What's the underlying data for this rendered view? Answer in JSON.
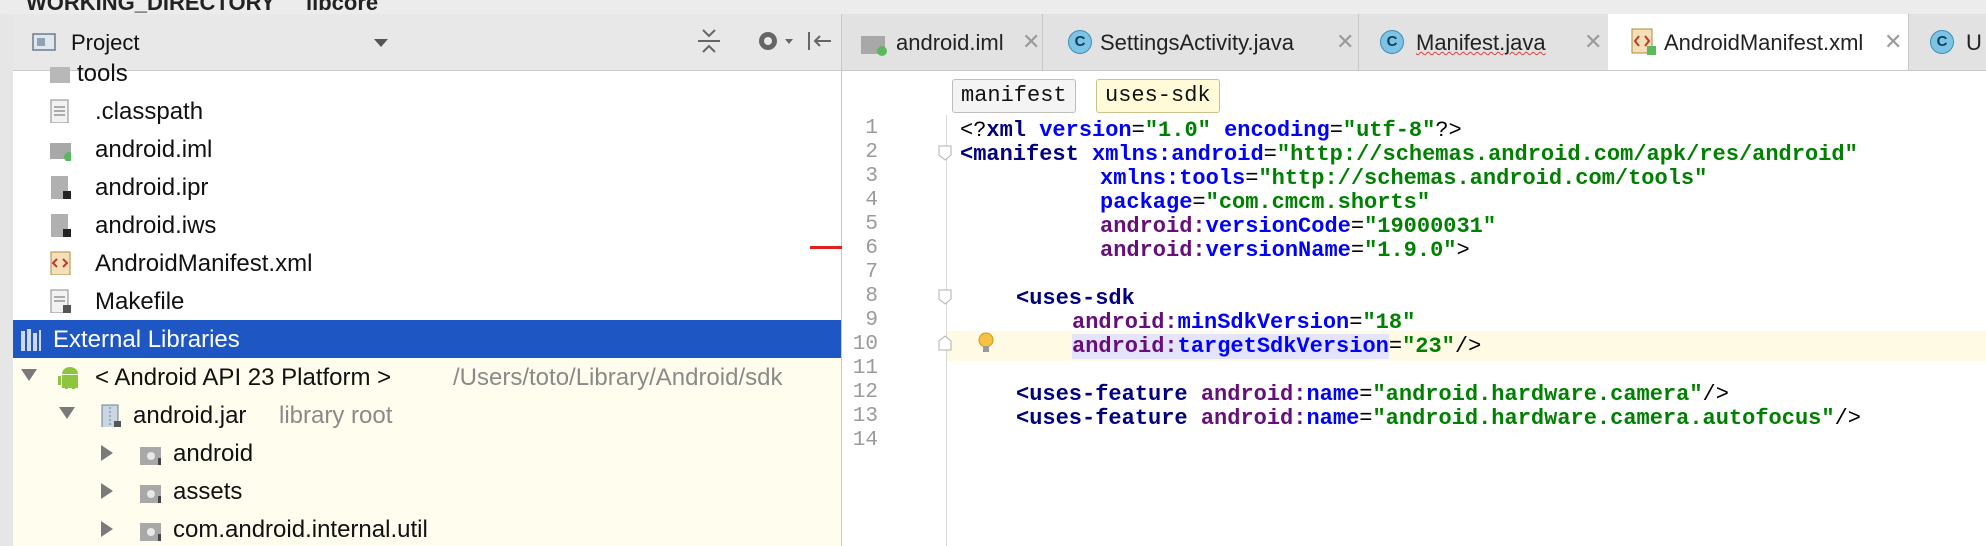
{
  "breadcrumb": {
    "items": [
      "WORKING_DIRECTORY",
      "libcore"
    ]
  },
  "project_panel": {
    "title": "Project",
    "tree": [
      {
        "label": "tools",
        "indent": 0
      },
      {
        "label": ".classpath",
        "icon": "text-file-icon"
      },
      {
        "label": "android.iml",
        "icon": "module-file-icon"
      },
      {
        "label": "android.ipr",
        "icon": "project-file-icon"
      },
      {
        "label": "android.iws",
        "icon": "workspace-file-icon"
      },
      {
        "label": "AndroidManifest.xml",
        "icon": "xml-file-icon"
      },
      {
        "label": "Makefile",
        "icon": "text-file-icon"
      },
      {
        "label": "External Libraries",
        "icon": "library-icon",
        "selected": true
      },
      {
        "label": "< Android API 23 Platform >",
        "suffix": "/Users/toto/Library/Android/sdk",
        "icon": "android-icon"
      },
      {
        "label": "android.jar",
        "suffix": "library root",
        "icon": "jar-icon"
      },
      {
        "label": "android",
        "icon": "package-folder-icon"
      },
      {
        "label": "assets",
        "icon": "package-folder-icon"
      },
      {
        "label": "com.android.internal.util",
        "icon": "package-folder-icon"
      }
    ]
  },
  "editor": {
    "tabs": [
      {
        "label": "android.iml",
        "icon": "module-file-icon",
        "active": false
      },
      {
        "label": "SettingsActivity.java",
        "icon": "class-icon",
        "active": false
      },
      {
        "label": "Manifest.java",
        "icon": "class-icon",
        "active": false,
        "error": true
      },
      {
        "label": "AndroidManifest.xml",
        "icon": "xml-file-icon",
        "active": true
      },
      {
        "label": "U",
        "icon": "class-icon",
        "active": false
      }
    ],
    "crumbs": [
      "manifest",
      "uses-sdk"
    ],
    "current_line": 10,
    "lines": [
      {
        "n": "1"
      },
      {
        "n": "2"
      },
      {
        "n": "3"
      },
      {
        "n": "4"
      },
      {
        "n": "5"
      },
      {
        "n": "6"
      },
      {
        "n": "7"
      },
      {
        "n": "8"
      },
      {
        "n": "9"
      },
      {
        "n": "10"
      },
      {
        "n": "11"
      },
      {
        "n": "12"
      },
      {
        "n": "13"
      },
      {
        "n": "14"
      }
    ],
    "code": {
      "l1": {
        "open": "<?",
        "xml": "xml",
        "a1": "version",
        "v1": "\"1.0\"",
        "a2": "encoding",
        "v2": "\"utf-8\"",
        "close": "?>"
      },
      "l2": {
        "tag": "<manifest",
        "ns": "xmlns:android",
        "val": "\"http://schemas.android.com/apk/res/android\""
      },
      "l3": {
        "ns": "xmlns:tools",
        "val": "\"http://schemas.android.com/tools\""
      },
      "l4": {
        "attr": "package",
        "val": "\"com.cmcm.shorts\""
      },
      "l5": {
        "ns": "android:",
        "attr": "versionCode",
        "val": "\"19000031\""
      },
      "l6": {
        "ns": "android:",
        "attr": "versionName",
        "val": "\"1.9.0\"",
        "close": ">"
      },
      "l8": {
        "tag": "<uses-sdk"
      },
      "l9": {
        "ns": "android:",
        "attr": "minSdkVersion",
        "val": "\"18\""
      },
      "l10": {
        "ns": "android:",
        "attr": "targetSdkVersion",
        "val": "\"23\"",
        "close": "/>"
      },
      "l12": {
        "tag": "<uses-feature",
        "ns": "android:",
        "attr": "name",
        "val": "\"android.hardware.camera\"",
        "close": "/>"
      },
      "l13": {
        "tag": "<uses-feature",
        "ns": "android:",
        "attr": "name",
        "val": "\"android.hardware.camera.autofocus\"",
        "close": "/>"
      }
    }
  },
  "colors": {
    "selection": "#1e56c4",
    "xml_tag": "#000080",
    "xml_namespace": "#660e7a",
    "xml_attribute": "#0000ff",
    "xml_value": "#008000",
    "current_line_bg": "#fffae3"
  }
}
